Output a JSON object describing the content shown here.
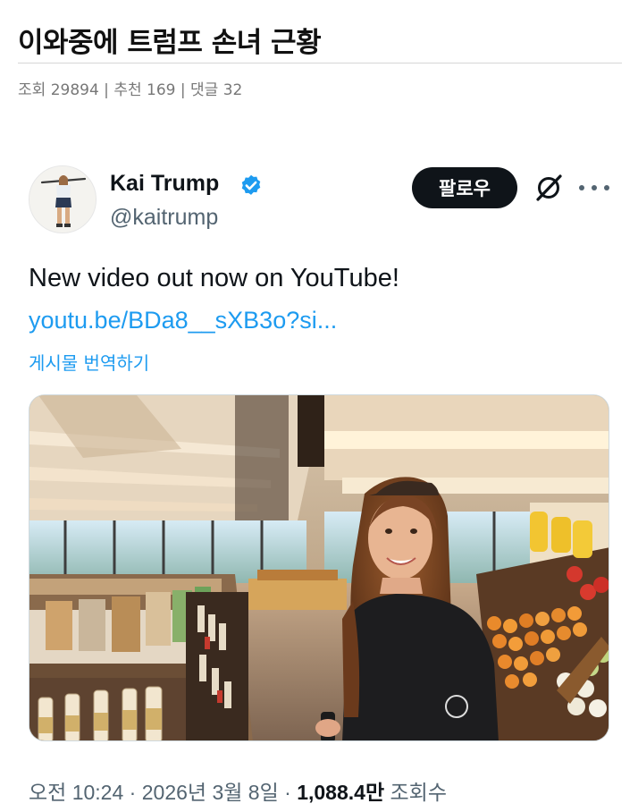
{
  "post": {
    "title": "이와중에 트럼프 손녀 근황",
    "views_label": "조회",
    "views": "29894",
    "recommend_label": "추천",
    "recommend": "169",
    "comments_label": "댓글",
    "comments": "32"
  },
  "tweet": {
    "author_name": "Kai Trump",
    "handle": "@kaitrump",
    "follow_label": "팔로우",
    "text": "New video out now on YouTube!",
    "link": "youtu.be/BDa8__sXB3o?si...",
    "translate_label": "게시물 번역하기",
    "time": "오전 10:24",
    "date": "2026년 3월 8일",
    "views": "1,088.4만",
    "views_label": "조회수"
  },
  "icons": {
    "verified": "verified-badge-icon",
    "grok": "grok-icon",
    "more": "more-options-icon"
  },
  "colors": {
    "accent": "#1d9bf0",
    "follow_bg": "#0f1419",
    "secondary_text": "#536471"
  }
}
